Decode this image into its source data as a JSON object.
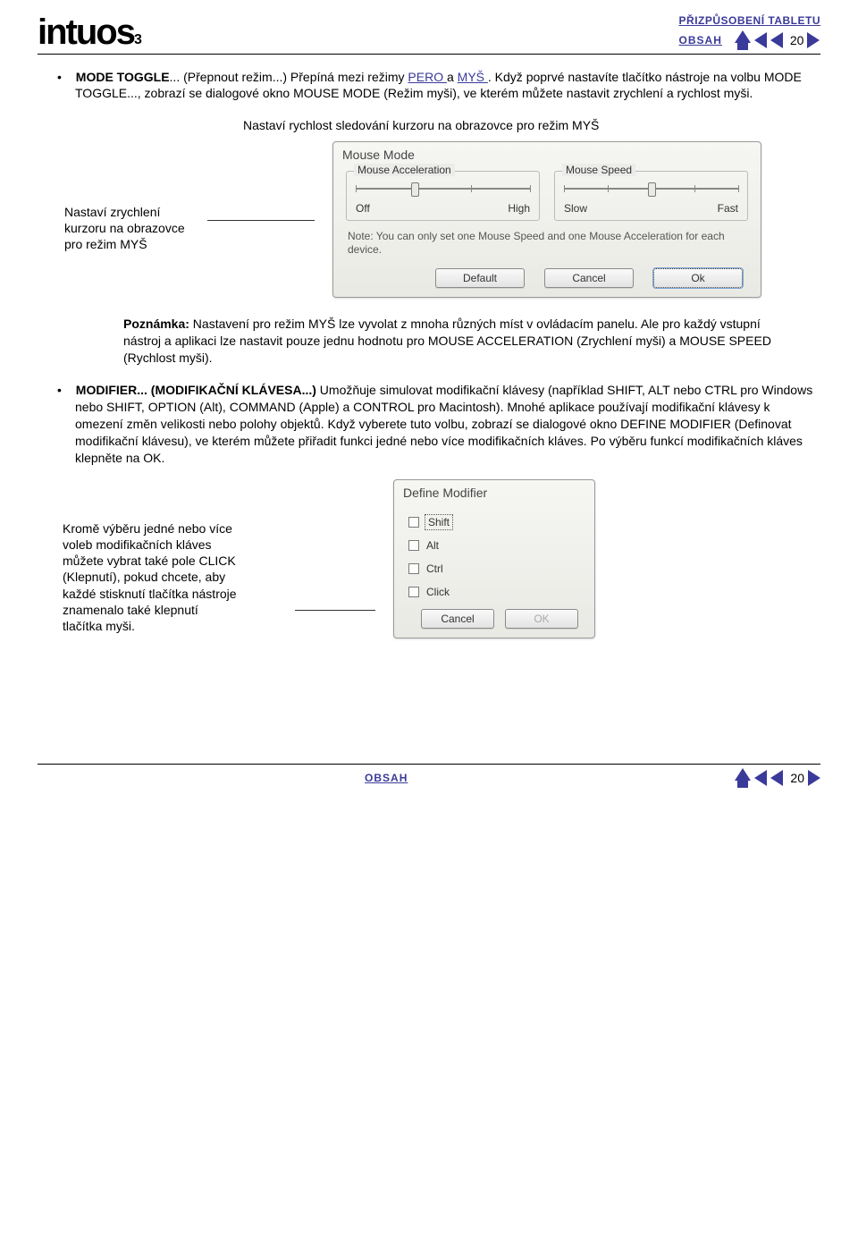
{
  "header": {
    "logo_text": "intuos",
    "logo_sub": "3",
    "obsah_label": "OBSAH",
    "top_link": "PŘIZPŮSOBENÍ TABLETU",
    "page_number": "20"
  },
  "para1": {
    "mode_toggle": "MODE TOGGLE",
    "t1": "... (Přepnout režim...) Přepíná mezi režimy ",
    "link_pero": "PERO ",
    "t2": "a ",
    "link_mys": "MYŠ ",
    "t3": ". Když poprvé nastavíte tlačítko nástroje na volbu ",
    "mode_toggle2": "MODE TOGGLE",
    "t4": "..., zobrazí se dialogové okno ",
    "mouse_mode": "MOUSE MODE",
    "t5": " (Režim myši), ve kterém můžete nastavit zrychlení a rychlost myši."
  },
  "callout_top": "Nastaví rychlost sledování kurzoru na obrazovce pro režim MYŠ",
  "callout_left": {
    "l1": "Nastaví zrychlení",
    "l2": "kurzoru na obrazovce",
    "l3": "pro režim MYŠ"
  },
  "mouse_dialog": {
    "title": "Mouse Mode",
    "accel_legend": "Mouse Acceleration",
    "speed_legend": "Mouse Speed",
    "accel_off": "Off",
    "accel_high": "High",
    "speed_slow": "Slow",
    "speed_fast": "Fast",
    "note": "Note: You can only set one Mouse Speed and one Mouse Acceleration for each device.",
    "btn_default": "Default",
    "btn_cancel": "Cancel",
    "btn_ok": "Ok"
  },
  "note_block": {
    "b": "Poznámka:",
    "t1": " Nastavení pro režim MYŠ lze vyvolat z mnoha různých míst v ovládacím panelu. Ale pro každý vstupní nástroj a aplikaci lze nastavit pouze jednu hodnotu pro ",
    "ma": "MOUSE ACCELERATION",
    "t2": " (Zrychlení myši) a ",
    "ms": "MOUSE SPEED",
    "t3": " (Rychlost myši)."
  },
  "modifier_para": {
    "bold": "MODIFIER... (MODIFIKAČNÍ KLÁVESA...)",
    "t1": " Umožňuje simulovat modifikační klávesy (například SHIFT, ALT nebo CTRL pro Windows nebo SHIFT, OPTION (Alt), COMMAND (Apple) a CONTROL pro Macintosh). Mnohé aplikace používají modifikační klávesy k omezení změn velikosti nebo polohy objektů. Když vyberete tuto volbu, zobrazí se dialogové okno ",
    "dm": "DEFINE MODIFIER",
    "t2": " (Definovat modifikační klávesu), ve kterém můžete přiřadit funkci jedné nebo více modifikačních kláves. Po výběru funkcí modifikačních kláves klepněte na OK."
  },
  "modifier_text": {
    "l1": "Kromě výběru jedné nebo více",
    "l2": "voleb modifikačních kláves",
    "l3": "můžete vybrat také pole CLICK",
    "l4": "(Klepnutí), pokud chcete, aby",
    "l5": "každé stisknutí tlačítka nástroje",
    "l6": "znamenalo také klepnutí",
    "l7": "tlačítka myši."
  },
  "modifier_dialog": {
    "title": "Define Modifier",
    "shift": "Shift",
    "alt": "Alt",
    "ctrl": "Ctrl",
    "click": "Click",
    "btn_cancel": "Cancel",
    "btn_ok": "OK"
  },
  "footer": {
    "obsah_label": "OBSAH",
    "page_number": "20"
  }
}
